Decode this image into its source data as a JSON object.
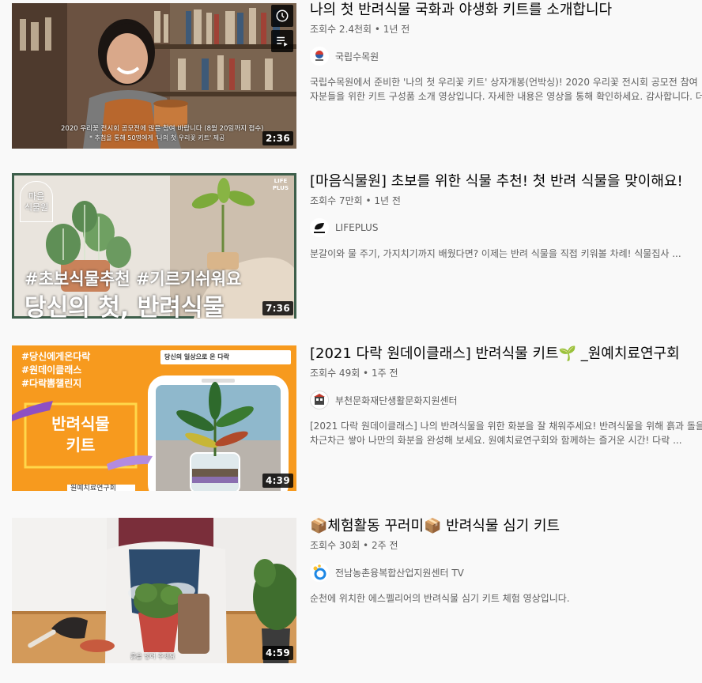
{
  "videos": [
    {
      "title": "나의 첫 반려식물 국화과 야생화 키트를 소개합니다",
      "meta": "조회수 2.4천회 • 1년 전",
      "channel": "국립수목원",
      "description": "국립수목원에서 준비한 '나의 첫 우리꽃 키트' 상자개봉(언박싱)! 2020 우리꽃 전시회 공모전 참여자분들을 위한 키트 구성품 소개 영상입니다. 자세한 내용은 영상을 통해 확인하세요. 감사합니다. 더보기의 ...",
      "duration": "2:36",
      "thumb_caption_1": "2020 우리꽃 전시회 공모전에 많은 참여 바랍니다 (8월 20일까지 접수)",
      "thumb_caption_2": "* 추첨을 통해 50명에게 '나의 첫 우리꽃 키트' 제공"
    },
    {
      "title": "[마음식물원] 초보를 위한 식물 추천! 첫 반려 식물을 맞이해요!",
      "meta": "조회수 7만회 • 1년 전",
      "channel": "LIFEPLUS",
      "description": "분갈이와 물 주기, 가지치기까지 배웠다면? 이제는 반려 식물을 직접 키워볼 차례! 식물집사 ...",
      "duration": "7:36",
      "thumb_badge": "마음\n식물원",
      "thumb_tags": "#초보식물추천 #기르기쉬워요",
      "thumb_headline": "당신의 첫, 반려식물",
      "thumb_logo": "LIFE\nPLUS"
    },
    {
      "title": "[2021 다락 원데이클래스] 반려식물 키트🌱 _원예치료연구회",
      "meta": "조회수 49회 • 1주 전",
      "channel": "부천문화재단생활문화지원센터",
      "description": "[2021 다락 원데이클래스] 나의 반려식물을 위한 화분을 잘 채워주세요! 반려식물을 위해 흙과 돌을 차근차근 쌓아 나만의 화분을 완성해 보세요. 원예치료연구회와 함께하는 즐거운 시간! 다락 ...",
      "duration": "4:39",
      "thumb_tags": [
        "#당신에게온다락",
        "#원데이클래스",
        "#다락뽐챌린지"
      ],
      "thumb_kit": "반려식물\n키트",
      "thumb_org": "원예치료연구회",
      "thumb_banner": "당신의 일상으로 온 다락"
    },
    {
      "title": "📦체험활동 꾸러미📦 반려식물 심기 키트",
      "meta": "조회수 30회 • 2주 전",
      "channel": "전남농촌융복합산업지원센터 TV",
      "description": "순천에 위치한 에스펠리어의 반려식물 심기 키트 체험 영상입니다.",
      "duration": "4:59",
      "thumb_caption": "흙을 넣어 주세요"
    }
  ],
  "colors": {
    "title": "#030303",
    "meta": "#606060",
    "orange": "#f79a1e",
    "frame_green": "#3d5e4a"
  },
  "icons": {
    "watch_later": "clock-icon",
    "add_to_queue": "playlist-add-icon"
  }
}
